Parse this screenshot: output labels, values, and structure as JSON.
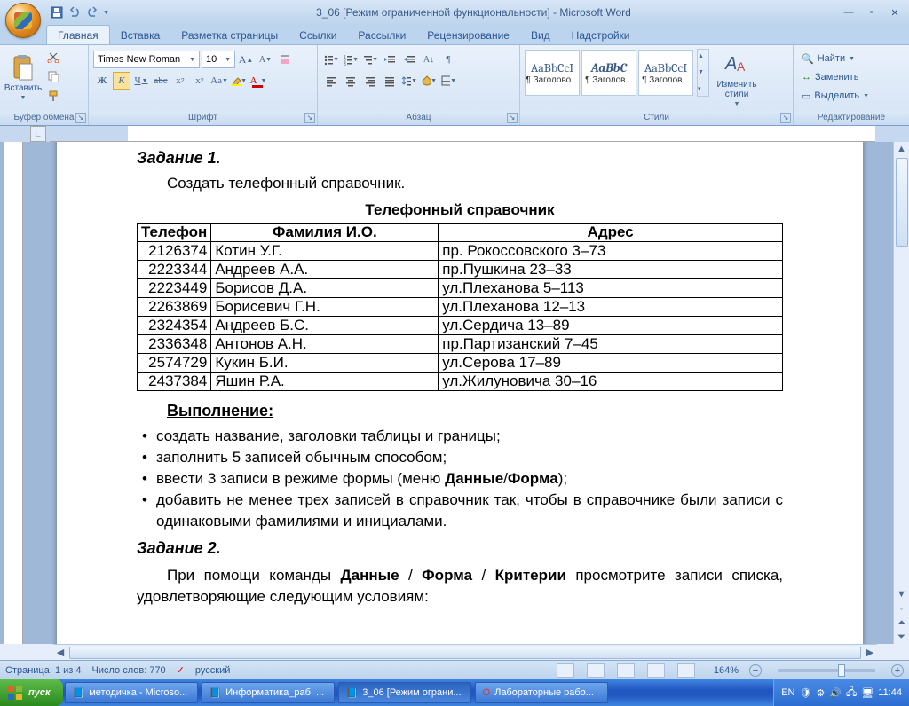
{
  "window": {
    "title": "3_06 [Режим ограниченной функциональности] - Microsoft Word"
  },
  "ribbon": {
    "tabs": [
      "Главная",
      "Вставка",
      "Разметка страницы",
      "Ссылки",
      "Рассылки",
      "Рецензирование",
      "Вид",
      "Надстройки"
    ],
    "active_tab": 0,
    "clipboard": {
      "label": "Буфер обмена",
      "paste": "Вставить"
    },
    "font": {
      "label": "Шрифт",
      "name": "Times New Roman",
      "size": "10"
    },
    "paragraph": {
      "label": "Абзац"
    },
    "styles": {
      "label": "Стили",
      "items": [
        {
          "sample": "AaBbCcI",
          "name": "¶ Заголово..."
        },
        {
          "sample": "AaBbC",
          "name": "¶ Заголов..."
        },
        {
          "sample": "AaBbCcI",
          "name": "¶ Заголов..."
        }
      ],
      "change": "Изменить стили"
    },
    "editing": {
      "label": "Редактирование",
      "find": "Найти",
      "replace": "Заменить",
      "select": "Выделить"
    }
  },
  "document": {
    "task1_title": "Задание 1.",
    "task1_body": "Создать телефонный справочник.",
    "table_title": "Телефонный справочник",
    "headers": [
      "Телефон",
      "Фамилия И.О.",
      "Адрес"
    ],
    "rows": [
      [
        "2126374",
        "Котин У.Г.",
        "пр. Рокоссовского 3–73"
      ],
      [
        "2223344",
        "Андреев А.А.",
        "пр.Пушкина 23–33"
      ],
      [
        "2223449",
        "Борисов Д.А.",
        "ул.Плеханова 5–113"
      ],
      [
        "2263869",
        "Борисевич Г.Н.",
        "ул.Плеханова 12–13"
      ],
      [
        "2324354",
        "Андреев Б.С.",
        "ул.Сердича 13–89"
      ],
      [
        "2336348",
        "Антонов А.Н.",
        "пр.Партизанский 7–45"
      ],
      [
        "2574729",
        "Кукин Б.И.",
        "ул.Серова 17–89"
      ],
      [
        "2437384",
        "Яшин Р.А.",
        "ул.Жилуновича 30–16"
      ]
    ],
    "exec_heading": "Выполнение",
    "bullets_plain": [
      "создать название, заголовки таблицы и границы;",
      "заполнить 5 записей обычным способом;"
    ],
    "bullet3_pre": " ввести 3 записи  в режиме формы (меню ",
    "bullet3_b1": "Данные",
    "bullet3_sep": "/",
    "bullet3_b2": "Форма",
    "bullet3_post": ");",
    "bullet4": " добавить не менее трех записей в справочник так, чтобы в справоч­нике были записи с одинаковыми фамилиями и инициалами.",
    "task2_title": "Задание 2.",
    "task2_pre": "При помощи команды ",
    "task2_b1": "Данные",
    "task2_s1": " / ",
    "task2_b2": "Форма",
    "task2_s2": " / ",
    "task2_b3": "Критерии",
    "task2_post": " просмотрите записи списка, удовлетворяющие следующим условиям:"
  },
  "status": {
    "page": "Страница: 1 из 4",
    "words": "Число слов: 770",
    "lang": "русский",
    "zoom": "164%"
  },
  "taskbar": {
    "start": "пуск",
    "tasks": [
      "методичка - Microso...",
      "Информатика_раб. ...",
      "3_06 [Режим ограни...",
      "Лабораторные рабо..."
    ],
    "lang": "EN",
    "clock": "11:44"
  }
}
